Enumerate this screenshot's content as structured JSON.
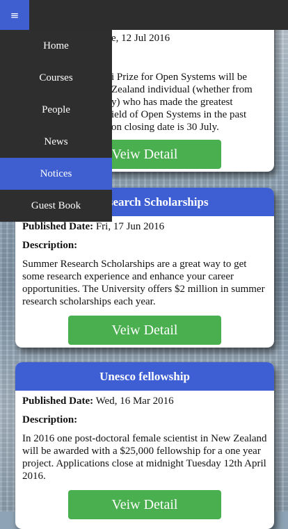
{
  "menu_icon": "hamburger-icon",
  "nav": {
    "items": [
      {
        "label": "Home",
        "active": false
      },
      {
        "label": "Courses",
        "active": false
      },
      {
        "label": "People",
        "active": false
      },
      {
        "label": "News",
        "active": false
      },
      {
        "label": "Notices",
        "active": true
      },
      {
        "label": "Guest Book",
        "active": false
      }
    ]
  },
  "card1": {
    "date_fragment": "e, 12 Jul 2016",
    "lines": [
      "i Prize for Open Systems will be",
      "Zealand individual (whether from",
      "y) who has made the greatest",
      "ield of Open Systems in the past",
      "on closing date is 30 July."
    ],
    "button": "Veiw Detail"
  },
  "card2": {
    "title": "Research Scholarships",
    "published_label": "Published Date:",
    "published_value": "Fri, 17 Jun 2016",
    "description_label": "Description:",
    "description": "Summer Research Scholarships are a great way to get some research experience and enhance your career opportunities. The University offers $2 million in summer research scholarships each year.",
    "button": "Veiw Detail"
  },
  "card3": {
    "title": "Unesco fellowship",
    "published_label": "Published Date:",
    "published_value": "Wed, 16 Mar 2016",
    "description_label": "Description:",
    "description": "In 2016 one post-doctoral female scientist in New Zealand will be awarded with a $25,000 fellowship for a one year project. Applications close at midnight Tuesday 12th April 2016.",
    "button": "Veiw Detail"
  },
  "colors": {
    "accent": "#3e5fd3",
    "button": "#4aaf4e",
    "nav_bg": "#2e2e2e"
  }
}
